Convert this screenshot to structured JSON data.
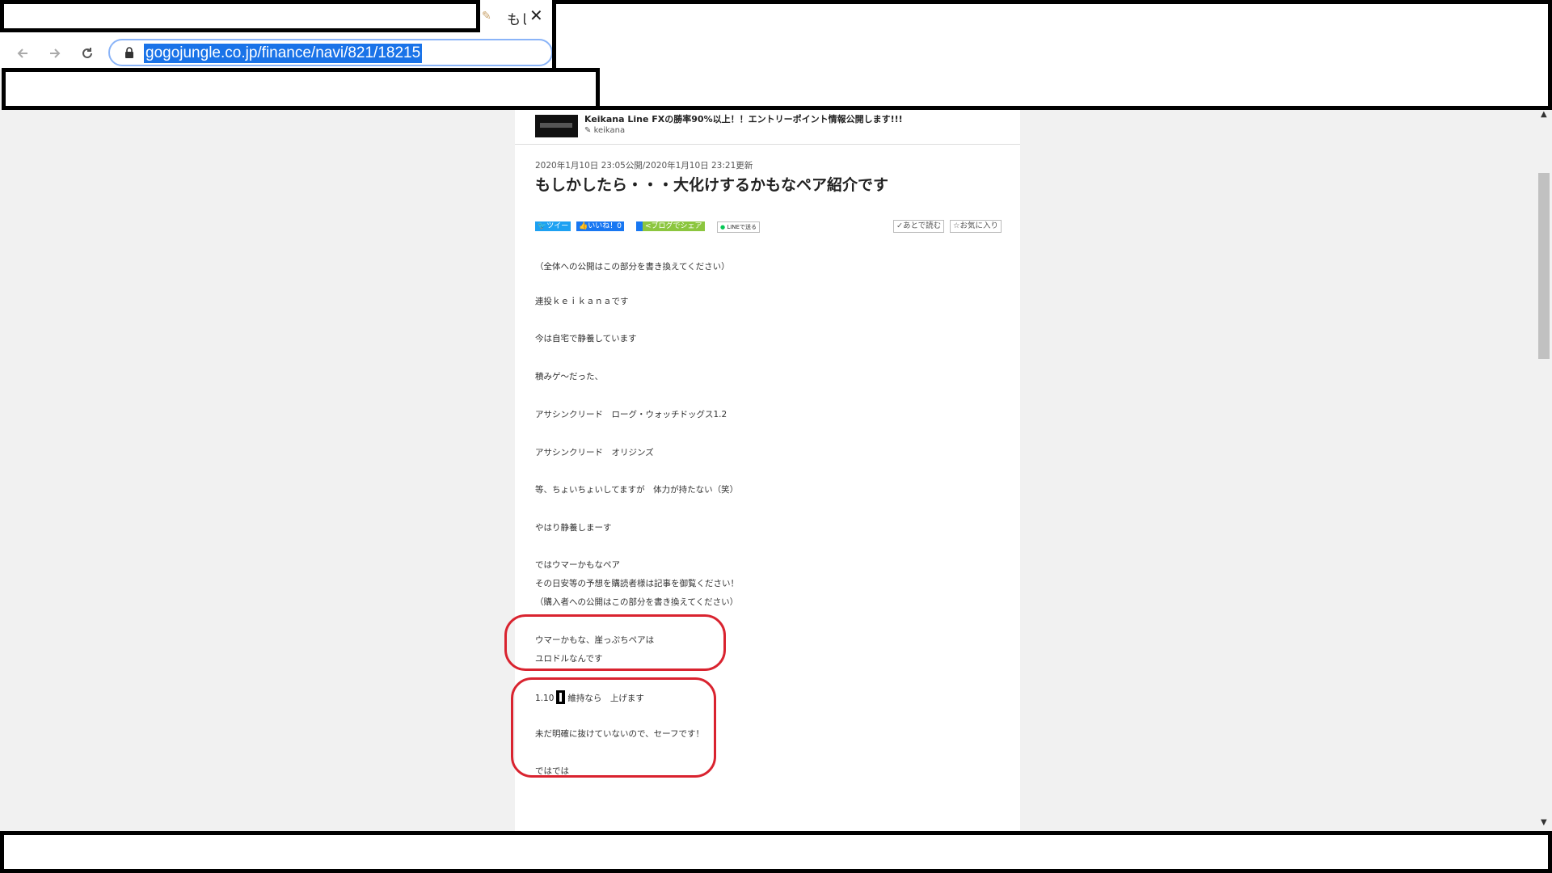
{
  "browser": {
    "tab": {
      "title": "もしかしたら・・・大化けするかもなペア紹介です",
      "close_glyph": "✕"
    },
    "url": "gogojungle.co.jp/finance/navi/821/18215"
  },
  "blog": {
    "name": "Keikana Line FXの勝率90%以上！！エントリーポイント情報公開します!!!",
    "author": "keikana"
  },
  "article": {
    "meta": "2020年1月10日 23:05公開/2020年1月10日 23:21更新",
    "title": "もしかしたら・・・大化けするかもなペア紹介です",
    "share": {
      "tweet": "ツイー",
      "like": "いいね！0",
      "blog_share": "ブログでシェア",
      "line": "LINEで送る",
      "read_later": "あとで読む",
      "favorite": "お気に入り"
    },
    "lines": [
      "（全体への公開はこの部分を書き換えてください）",
      "連投ｋｅｉｋａｎａです",
      "今は自宅で静養しています",
      "積みゲ～だった、",
      "アサシンクリード　ローグ・ウォッチドッグス1.2",
      "アサシンクリード　オリジンズ",
      "等、ちょいちょいしてますが　体力が持たない（笑）",
      "やはり静養しまーす",
      "ではウマーかもなペア",
      "その日安等の予想を購読者様は記事を御覧ください！",
      "（購入者への公開はこの部分を書き換えてください）",
      "ウマーかもな、崖っぷちペアは",
      "ユロドルなんです",
      "1.10",
      "維持なら　上げます",
      "未だ明確に抜けていないので、セーフです！",
      "ではでは"
    ]
  }
}
